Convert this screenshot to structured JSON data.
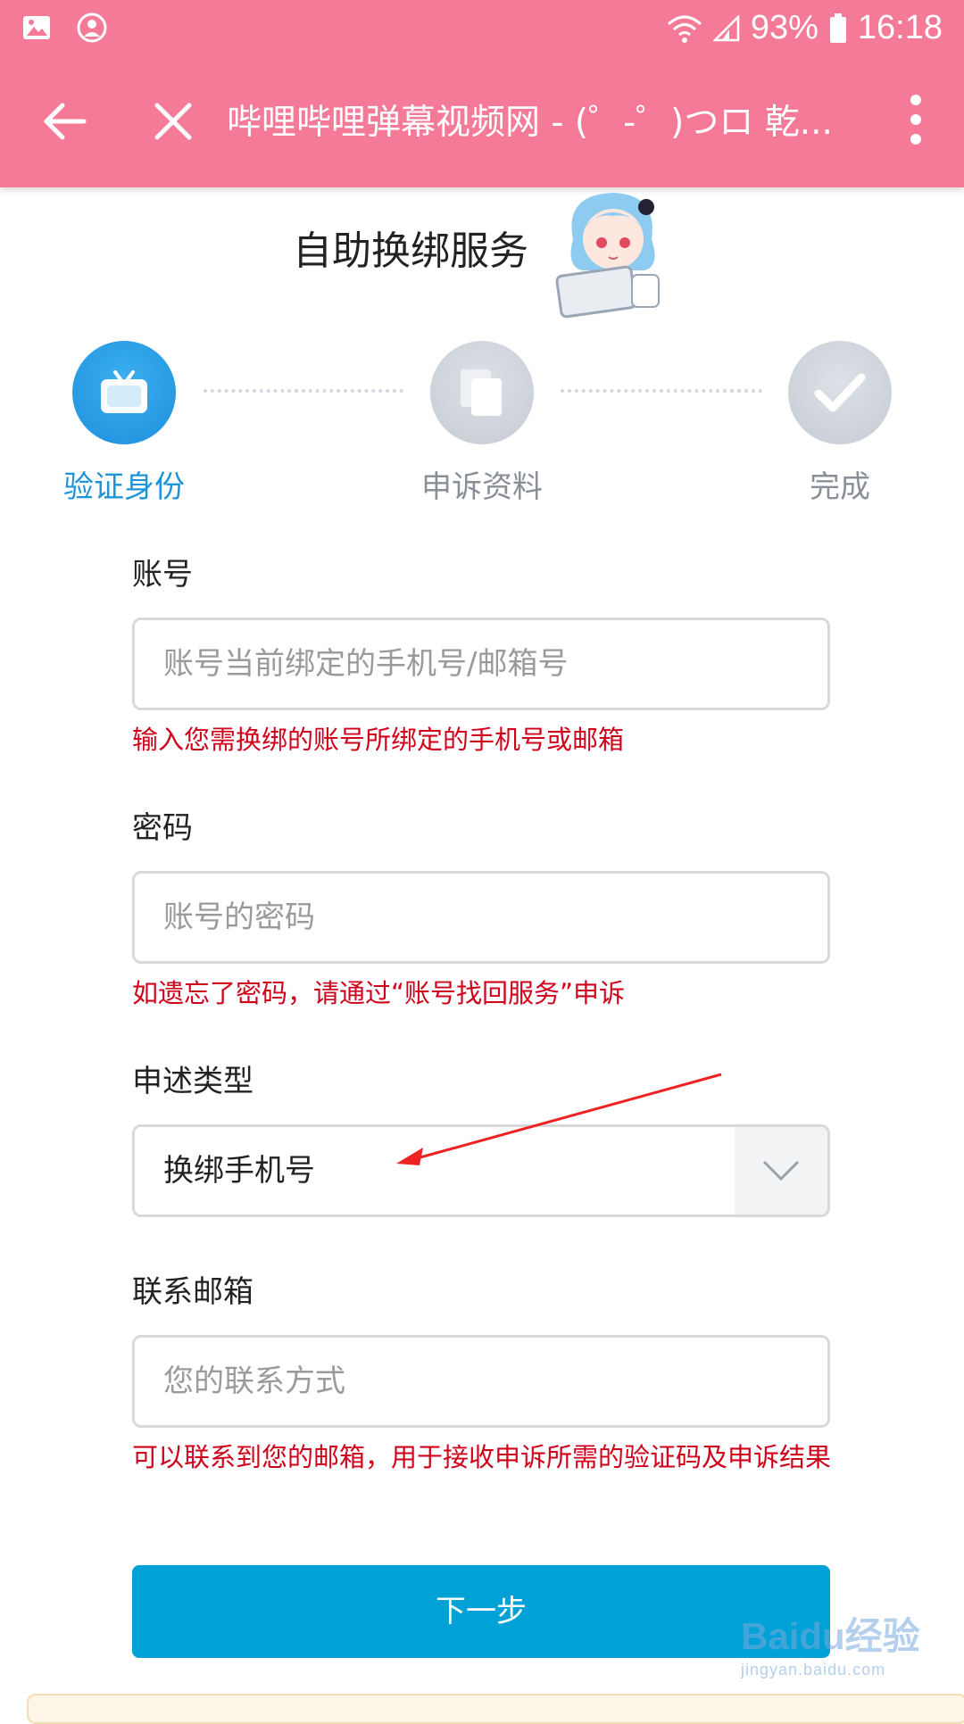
{
  "status_bar": {
    "battery_percent": "93%",
    "time": "16:18",
    "icons": [
      "gallery-icon",
      "account-icon",
      "wifi-icon",
      "signal-icon",
      "battery-icon"
    ]
  },
  "titlebar": {
    "title": "哔哩哔哩弹幕视频网 - (゜-゜)つロ 乾...",
    "icons": [
      "back-arrow-icon",
      "close-icon",
      "more-vert-icon"
    ]
  },
  "page": {
    "heading": "自助换绑服务"
  },
  "steps": [
    {
      "label": "验证身份",
      "state": "active",
      "icon": "tv-icon"
    },
    {
      "label": "申诉资料",
      "state": "inactive",
      "icon": "documents-icon"
    },
    {
      "label": "完成",
      "state": "inactive",
      "icon": "checkmark-icon"
    }
  ],
  "form": {
    "account": {
      "label": "账号",
      "placeholder": "账号当前绑定的手机号/邮箱号",
      "value": "",
      "hint": "输入您需换绑的账号所绑定的手机号或邮箱"
    },
    "password": {
      "label": "密码",
      "placeholder": "账号的密码",
      "value": "",
      "hint": "如遗忘了密码，请通过“账号找回服务”申诉"
    },
    "appeal_type": {
      "label": "申述类型",
      "selected": "换绑手机号"
    },
    "contact_email": {
      "label": "联系邮箱",
      "placeholder": "您的联系方式",
      "value": "",
      "hint": "可以联系到您的邮箱，用于接收申诉所需的验证码及申诉结果"
    },
    "next_button": "下一步"
  },
  "watermark": {
    "brand": "Baidu经验",
    "url": "jingyan.baidu.com"
  },
  "colors": {
    "appbar": "#f57a98",
    "primary": "#00a1d6",
    "hint_red": "#d0021b",
    "step_active": "#2196e0",
    "step_inactive": "#c9ced7"
  }
}
